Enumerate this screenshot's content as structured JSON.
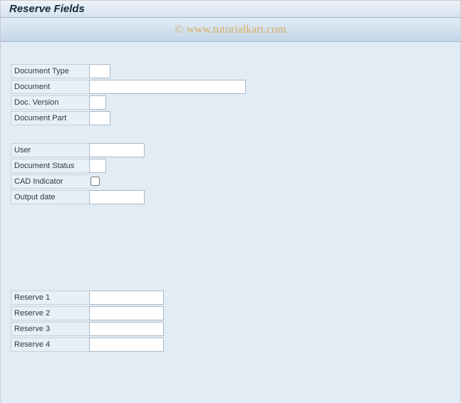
{
  "header": {
    "title": "Reserve Fields"
  },
  "watermark": "© www.tutorialkart.com",
  "groups": {
    "document": {
      "doc_type_label": "Document Type",
      "doc_label": "Document",
      "doc_version_label": "Doc. Version",
      "doc_part_label": "Document Part"
    },
    "meta": {
      "user_label": "User",
      "doc_status_label": "Document Status",
      "cad_label": "CAD Indicator",
      "output_date_label": "Output date"
    },
    "reserve": {
      "r1_label": "Reserve 1",
      "r2_label": "Reserve 2",
      "r3_label": "Reserve 3",
      "r4_label": "Reserve 4"
    }
  },
  "values": {
    "doc_type": "",
    "document": "",
    "doc_version": "",
    "doc_part": "",
    "user": "",
    "doc_status": "",
    "cad_indicator": false,
    "output_date": "",
    "reserve1": "",
    "reserve2": "",
    "reserve3": "",
    "reserve4": ""
  }
}
